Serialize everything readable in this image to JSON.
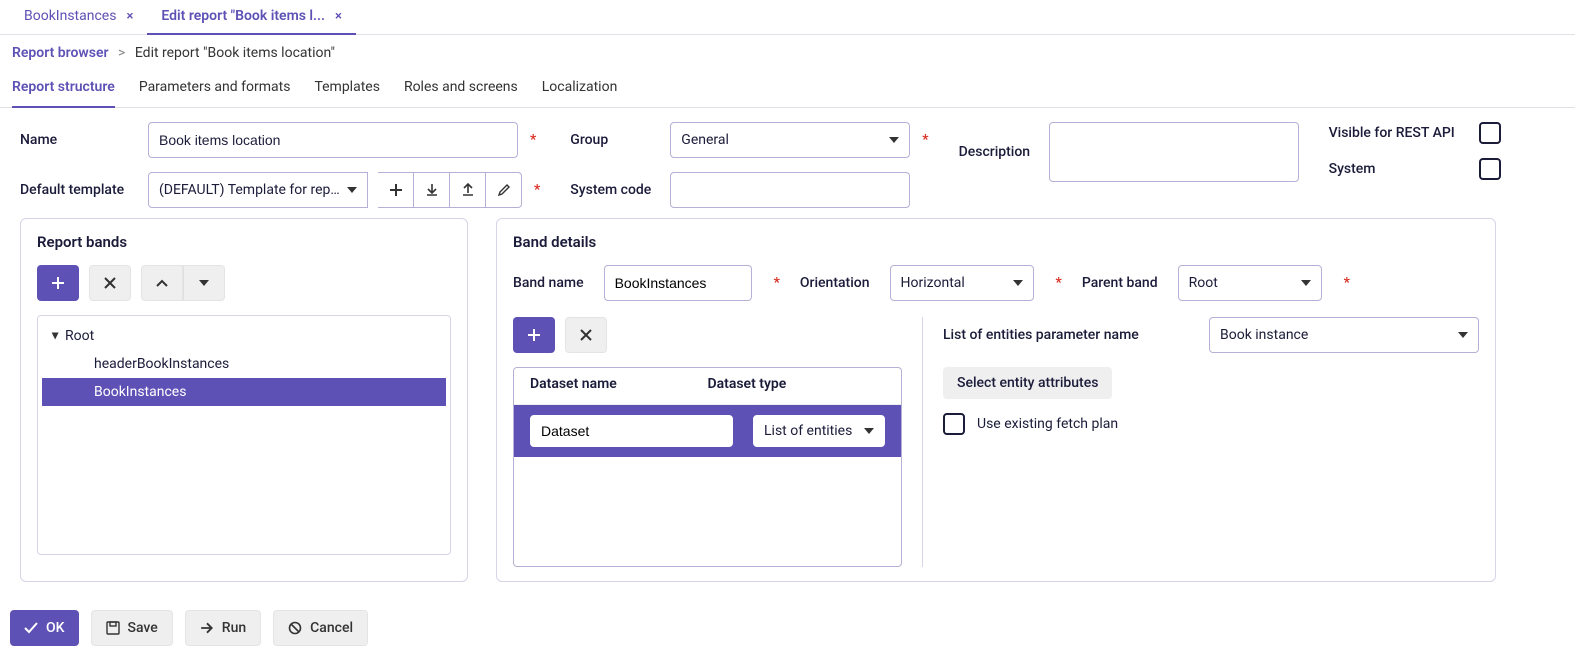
{
  "topTabs": [
    {
      "label": "BookInstances",
      "active": false
    },
    {
      "label": "Edit report \"Book items l...",
      "active": true
    }
  ],
  "breadcrumb": {
    "root": "Report browser",
    "current": "Edit report \"Book items location\""
  },
  "innerTabs": [
    {
      "label": "Report structure",
      "active": true
    },
    {
      "label": "Parameters and formats",
      "active": false
    },
    {
      "label": "Templates",
      "active": false
    },
    {
      "label": "Roles and screens",
      "active": false
    },
    {
      "label": "Localization",
      "active": false
    }
  ],
  "form": {
    "nameLabel": "Name",
    "name": "Book items location",
    "defaultTemplateLabel": "Default template",
    "defaultTemplate": "(DEFAULT) Template for report",
    "groupLabel": "Group",
    "group": "General",
    "systemCodeLabel": "System code",
    "systemCode": "",
    "descriptionLabel": "Description",
    "description": "",
    "visibleRestLabel": "Visible for REST API",
    "systemLabel": "System"
  },
  "leftPanel": {
    "title": "Report bands",
    "tree": {
      "root": "Root",
      "children": [
        {
          "label": "headerBookInstances",
          "selected": false
        },
        {
          "label": "BookInstances",
          "selected": true
        }
      ]
    }
  },
  "rightPanel": {
    "title": "Band details",
    "bandNameLabel": "Band name",
    "bandName": "BookInstances",
    "orientationLabel": "Orientation",
    "orientation": "Horizontal",
    "parentBandLabel": "Parent band",
    "parentBand": "Root",
    "datasetTable": {
      "headers": [
        "Dataset name",
        "Dataset type"
      ],
      "row": {
        "name": "Dataset",
        "type": "List of entities"
      }
    },
    "entitiesParamLabel": "List of entities parameter name",
    "entitiesParam": "Book instance",
    "selectEntityBtn": "Select entity attributes",
    "useExistingLabel": "Use existing fetch plan"
  },
  "footer": {
    "ok": "OK",
    "save": "Save",
    "run": "Run",
    "cancel": "Cancel"
  }
}
